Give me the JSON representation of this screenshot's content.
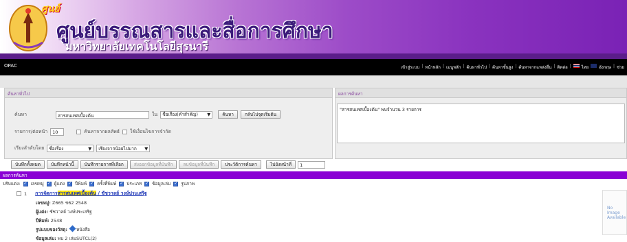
{
  "banner": {
    "small_title": "ศูนย์",
    "title": "ศูนย์บรรณสารและสื่อการศึกษา",
    "subtitle": "มหาวิทยาลัยเทคโนโลยีสุรนารี"
  },
  "navbar": {
    "opac": "OPAC",
    "links": [
      "เข้าสู่ระบบ",
      "หน้าหลัก",
      "เมนูหลัก",
      "ค้นหาทั่วไป",
      "ค้นหาขั้นสูง",
      "ค้นหาจากแหล่งอื่น",
      "ติดต่อ",
      "ไทย",
      "อังกฤษ",
      "ช่วย"
    ]
  },
  "search_panel": {
    "header": "ค้นหาทั่วไป",
    "search_label": "ค้นหา",
    "search_value": "สารสนเทศเบื้องต้น",
    "in_label": "ใน",
    "field_select": "ชื่อเรื่อง(คำสำคัญ)",
    "search_button": "ค้นหา",
    "back_button": "กลับไปจุดเริ่มต้น",
    "per_page_label": "รายการ/ต่อหน้า",
    "per_page_value": "10",
    "search_in_results": "ค้นหาจากผลลัพธ์",
    "limit": "ใช้เงื่อนไขการจำกัด",
    "sort_label": "เรียงลำดับโดย",
    "sort_field": "ชื่อเรื่อง",
    "sort_order": "เรียงจากน้อยไปมาก"
  },
  "result_panel": {
    "header": "ผลการค้นหา",
    "text": "\"สารสนเทศเบื้องต้น\" พบจำนวน 3 รายการ"
  },
  "toolbar": {
    "save_all": "บันทึกทั้งหมด",
    "save_page": "บันทึกหน้านี้",
    "save_selected": "บันทึกรายการที่เลือก",
    "send_saved": "ส่งออกข้อมูลที่บันทึก",
    "delete_saved": "ลบข้อมูลที่บันทึก",
    "history": "ประวัติการค้นหา",
    "goto_page": "ไปยังหน้าที่",
    "goto_value": "1"
  },
  "results_bar": "ผลการค้นหา",
  "formats": {
    "label": "ปรับแต่ง:",
    "items": [
      "เลขหมู่",
      "ผู้แต่ง",
      "ปีพิมพ์",
      "ครั้งที่พิมพ์",
      "ประเภท",
      "ข้อมูลเล่ม",
      "รูปภาพ"
    ]
  },
  "record": {
    "index": "1",
    "title_pre": "การจัดการ",
    "title_hl": "สารสนเทศเบื้องต้น",
    "title_post": " / ชัชวาลย์ วงษ์ประเสริฐ",
    "callno_label": "เลขหมู่:",
    "callno": "Z665 ช62 2548",
    "author_label": "ผู้แต่ง:",
    "author": "ชัชวาลย์ วงษ์ประเสริฐ",
    "year_label": "ปีพิมพ์:",
    "year": "2548",
    "type_label": "รูปแบบของวัสดุ:",
    "type": "หนังสือ",
    "holdings_label": "ข้อมูลเล่ม:",
    "holdings": "พบ 2 เล่มSUTCL(2)"
  },
  "noimage": {
    "line1": "No Image",
    "line2": "Available"
  }
}
